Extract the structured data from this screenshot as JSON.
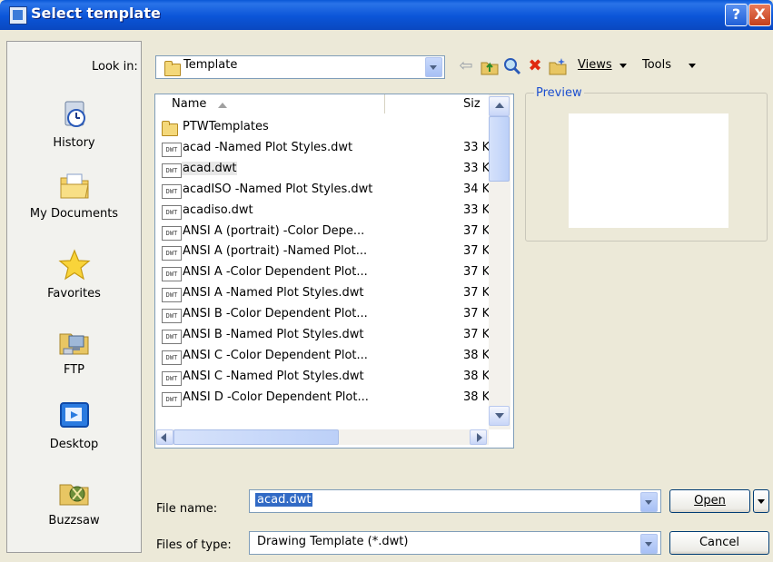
{
  "window": {
    "title": "Select template",
    "help_label": "?",
    "close_label": "X"
  },
  "places": [
    {
      "label": "History",
      "icon": "history-icon"
    },
    {
      "label": "My Documents",
      "icon": "my-documents-icon"
    },
    {
      "label": "Favorites",
      "icon": "favorites-star-icon"
    },
    {
      "label": "FTP",
      "icon": "ftp-icon"
    },
    {
      "label": "Desktop",
      "icon": "desktop-icon"
    },
    {
      "label": "Buzzsaw",
      "icon": "buzzsaw-icon"
    }
  ],
  "lookin": {
    "label": "Look in:",
    "value": "Template"
  },
  "toolbar": {
    "views_label": "Views",
    "tools_label": "Tools"
  },
  "filelist": {
    "columns": {
      "name": "Name",
      "size": "Siz"
    },
    "rows": [
      {
        "name": "PTWTemplates",
        "size": "",
        "type": "folder"
      },
      {
        "name": "acad -Named Plot Styles.dwt",
        "size": "33 K"
      },
      {
        "name": "acad.dwt",
        "size": "33 K"
      },
      {
        "name": "acadISO -Named Plot Styles.dwt",
        "size": "34 K"
      },
      {
        "name": "acadiso.dwt",
        "size": "33 K"
      },
      {
        "name": "ANSI A (portrait) -Color Depe...",
        "size": "37 K"
      },
      {
        "name": "ANSI A (portrait) -Named Plot...",
        "size": "37 K"
      },
      {
        "name": "ANSI A -Color Dependent Plot...",
        "size": "37 K"
      },
      {
        "name": "ANSI A -Named Plot Styles.dwt",
        "size": "37 K"
      },
      {
        "name": "ANSI B -Color Dependent Plot...",
        "size": "37 K"
      },
      {
        "name": "ANSI B -Named Plot Styles.dwt",
        "size": "37 K"
      },
      {
        "name": "ANSI C -Color Dependent Plot...",
        "size": "38 K"
      },
      {
        "name": "ANSI C -Named Plot Styles.dwt",
        "size": "38 K"
      },
      {
        "name": "ANSI D -Color Dependent Plot...",
        "size": "38 K"
      }
    ],
    "file_icon_text": "DWT",
    "selected_index": 2
  },
  "preview": {
    "label": "Preview"
  },
  "filename": {
    "label": "File name:",
    "value": "acad.dwt"
  },
  "filetype": {
    "label": "Files of type:",
    "value": "Drawing Template (*.dwt)"
  },
  "buttons": {
    "open": "Open",
    "cancel": "Cancel"
  },
  "colors": {
    "titlebar": "#0a58d6",
    "dialog_bg": "#ece9d8",
    "preview_label": "#1c4fcf"
  }
}
